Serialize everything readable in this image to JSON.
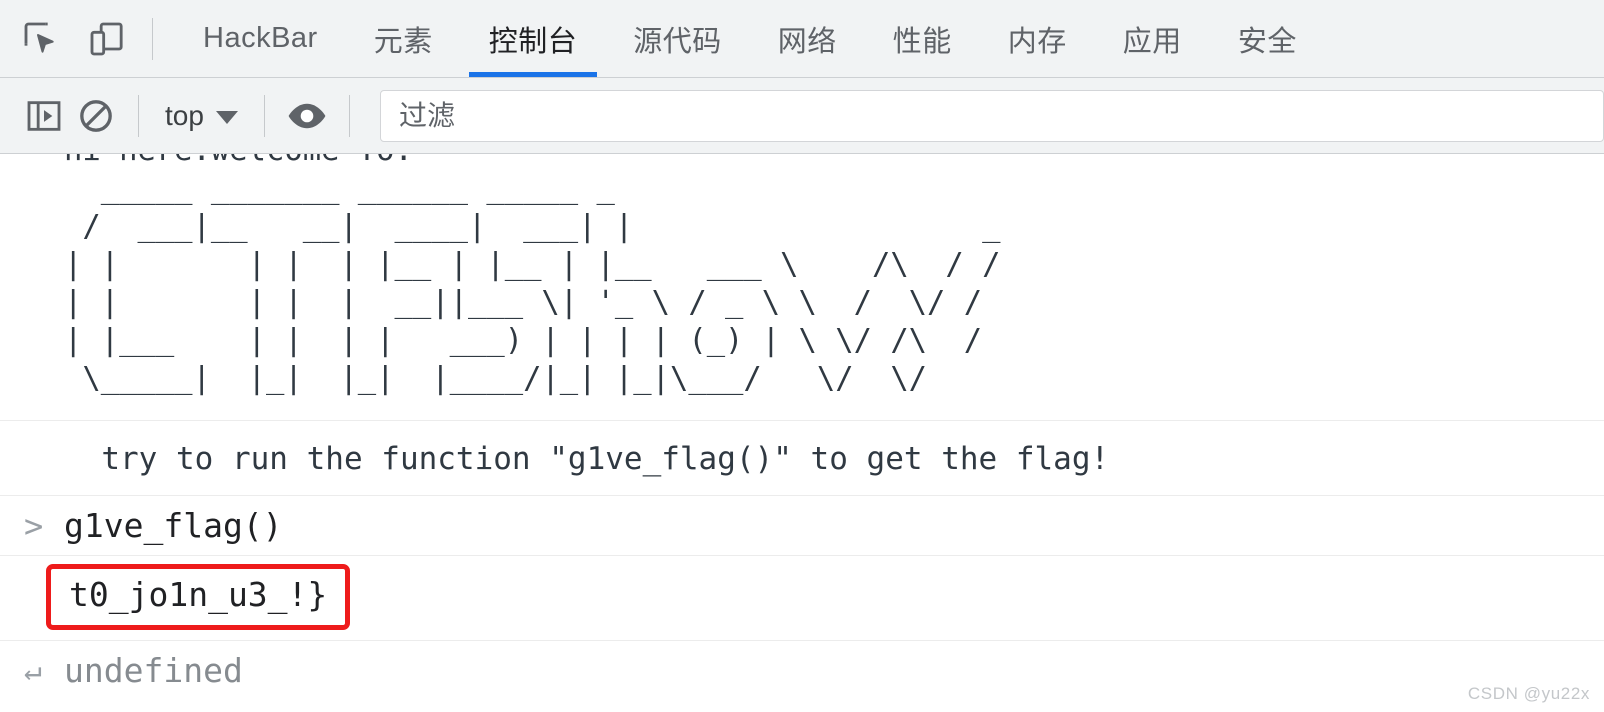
{
  "window": {
    "toolbar_icons": [
      {
        "name": "inspect-element-icon",
        "label": "检查元素"
      },
      {
        "name": "device-toolbar-icon",
        "label": "设备工具栏"
      }
    ],
    "tabs": [
      {
        "label": "HackBar",
        "active": false
      },
      {
        "label": "元素",
        "active": false
      },
      {
        "label": "控制台",
        "active": true
      },
      {
        "label": "源代码",
        "active": false
      },
      {
        "label": "网络",
        "active": false
      },
      {
        "label": "性能",
        "active": false
      },
      {
        "label": "内存",
        "active": false
      },
      {
        "label": "应用",
        "active": false
      },
      {
        "label": "安全",
        "active": false
      }
    ],
    "active_tab_accent": "#1a73e8"
  },
  "console_toolbar": {
    "sidebar_toggle_icon": "console-sidebar-icon",
    "clear_console_icon": "clear-console-icon",
    "context_selector": {
      "value": "top",
      "caret": "▼"
    },
    "eye_icon": "live-expression-eye-icon",
    "filter": {
      "value": "",
      "placeholder": "过滤"
    }
  },
  "console": {
    "messages": [
      {
        "type": "banner",
        "greeting": "hi~here:welcome To:",
        "ascii_art": "  _____ _______ ______ _____ _                      \n /  ___|__   __|  ____|  ___| |                   _  \n| |       | |  | |__ | |__ | |__   ___ \\    /\\  / /\n| |       | |  |  __||___ \\| '_ \\ / _ \\ \\  /  \\/ / \n| |___    | |  | |   ___) | | | | (_) | \\ \\/ /\\  /  \n \\_____|  |_|  |_|  |____/|_| |_|\\___/   \\/  \\/    "
      },
      {
        "type": "log",
        "text": "  try to run the function \"g1ve_flag()\" to get the flag!"
      },
      {
        "type": "input",
        "prompt": ">",
        "text": "g1ve_flag()"
      },
      {
        "type": "result",
        "text": "t0_jo1n_u3_!}",
        "highlight": true,
        "highlight_color": "#ee1b1b"
      },
      {
        "type": "return",
        "prompt": "↵",
        "text": "undefined"
      }
    ]
  },
  "watermark": {
    "text": "CSDN @yu22x"
  }
}
